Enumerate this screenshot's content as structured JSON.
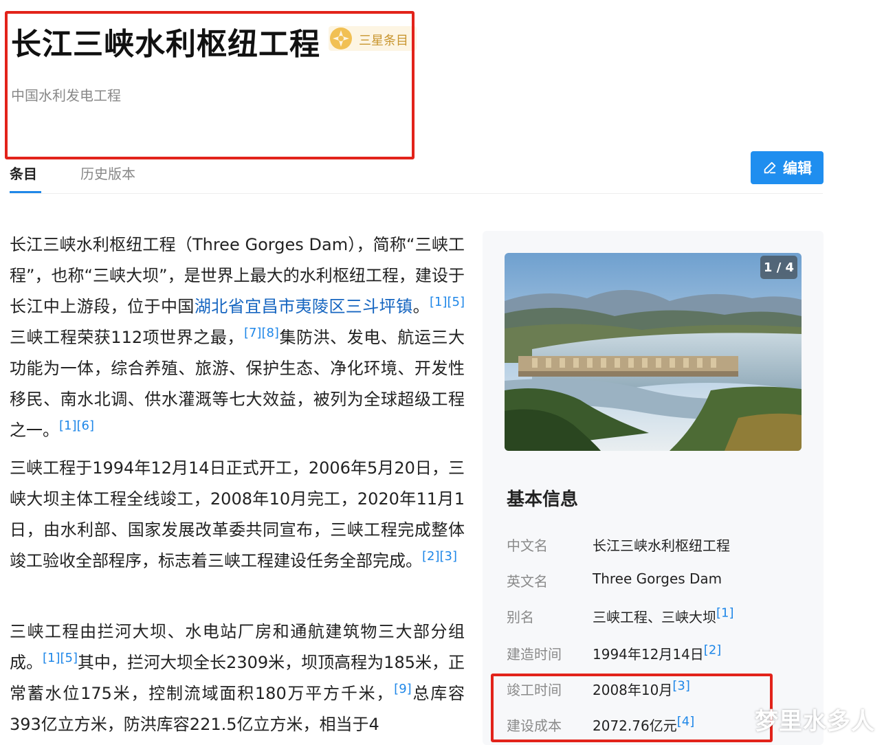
{
  "entry": {
    "title": "长江三峡水利枢纽工程",
    "badge": "三星条目",
    "subtitle": "中国水利发电工程"
  },
  "tabs": [
    {
      "label": "条目",
      "active": true
    },
    {
      "label": "历史版本",
      "active": false
    }
  ],
  "edit_button": {
    "label": "编辑"
  },
  "paragraphs": {
    "p1": {
      "t1": "长江三峡水利枢纽工程（Three Gorges Dam），简称“三峡工程”，也称“三峡大坝”，是世界上最大的水利枢纽工程，建设于长江中上游段，位于中国",
      "link": "湖北省宜昌市夷陵区三斗坪镇",
      "t2": "。",
      "ref1": "[1][5]",
      "t3": "三峡工程荣获112项世界之最，",
      "ref2": "[7][8]",
      "t4": "集防洪、发电、航运三大功能为一体，综合养殖、旅游、保护生态、净化环境、开发性移民、南水北调、供水灌溉等七大效益，被列为全球超级工程之一。",
      "ref3": "[1][6]"
    },
    "p2": {
      "t1": "三峡工程于1994年12月14日正式开工，2006年5月20日，三峡大坝主体工程全线竣工，2008年10月完工，2020年11月1日，由水利部、国家发展改革委共同宣布，三峡工程完成整体竣工验收全部程序，标志着三峡工程建设任务全部完成。",
      "ref1": "[2][3]"
    },
    "p3": {
      "t1": "三峡工程由拦河大坝、水电站厂房和通航建筑物三大部分组成。",
      "ref1": "[1][5]",
      "t2": "其中，拦河大坝全长2309米，坝顶高程为185米，正常蓄水位175米，控制流域面积180万平方千米，",
      "ref2": "[9]",
      "t3": "总库容393亿立方米，防洪库容221.5亿立方米，相当于4"
    }
  },
  "infobox": {
    "photo_counter": "1 / 4",
    "heading": "基本信息",
    "rows": [
      {
        "label": "中文名",
        "value": "长江三峡水利枢纽工程",
        "ref": ""
      },
      {
        "label": "英文名",
        "value": "Three Gorges Dam",
        "ref": ""
      },
      {
        "label": "别名",
        "value": "三峡工程、三峡大坝",
        "ref": "[1]"
      },
      {
        "label": "建造时间",
        "value": "1994年12月14日",
        "ref": "[2]"
      },
      {
        "label": "竣工时间",
        "value": "2008年10月",
        "ref": "[3]"
      },
      {
        "label": "建设成本",
        "value": "2072.76亿元",
        "ref": "[4]"
      }
    ]
  },
  "watermark": "梦里水多人",
  "colors": {
    "link": "#1565c0",
    "ref": "#1f87e8",
    "edit_button": "#1f8eef",
    "highlight_box": "#e2231a",
    "badge_text": "#c8952e"
  },
  "icons": {
    "badge": "three-star-badge-icon",
    "edit": "pencil-icon"
  }
}
